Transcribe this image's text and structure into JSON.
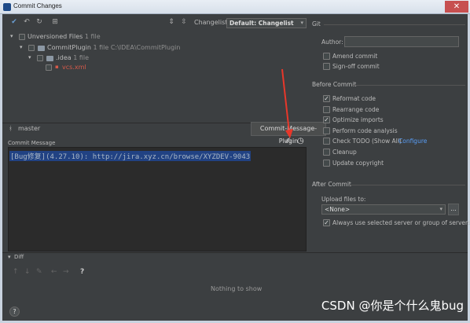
{
  "window": {
    "title": "Commit Changes",
    "close_glyph": "✕"
  },
  "toolbar": {
    "changelist_label": "Changelist:",
    "changelist_value": "Default: Changelist"
  },
  "tree": {
    "unversioned_label": "Unversioned Files",
    "unversioned_count": "1 file",
    "project_label": "CommitPlugin",
    "project_info": "1 file C:\\IDEA\\CommitPlugin",
    "folder_label": ".idea",
    "folder_count": "1 file",
    "file_label": "vcs.xml"
  },
  "branch": {
    "name": "master"
  },
  "commit_message": {
    "section_label": "Commit Message",
    "text": "[Bug修复](4.27.10): http://jira.xyz.cn/browse/XYZDEV-9043",
    "tooltip": "Commit-Message-Plugin"
  },
  "git": {
    "section_label": "Git",
    "author_label": "Author:",
    "author_value": "",
    "amend_label": "Amend commit",
    "amend_checked": false,
    "signoff_label": "Sign-off commit",
    "signoff_checked": false
  },
  "before_commit": {
    "section_label": "Before Commit",
    "options": [
      {
        "label": "Reformat code",
        "checked": true
      },
      {
        "label": "Rearrange code",
        "checked": false
      },
      {
        "label": "Optimize imports",
        "checked": true
      },
      {
        "label": "Perform code analysis",
        "checked": false
      },
      {
        "label": "Check TODO (Show All)",
        "checked": false,
        "link": "Configure"
      },
      {
        "label": "Cleanup",
        "checked": false
      },
      {
        "label": "Update copyright",
        "checked": false
      }
    ]
  },
  "after_commit": {
    "section_label": "After Commit",
    "upload_label": "Upload files to:",
    "upload_value": "<None>",
    "browse_label": "...",
    "always_use_label": "Always use selected server or group of servers",
    "always_use_checked": true
  },
  "diff": {
    "section_label": "Diff",
    "empty_text": "Nothing to show"
  },
  "footer": {
    "help_label": "?",
    "watermark": "CSDN @你是个什么鬼bug"
  },
  "colors": {
    "background": "#3c3f41",
    "editor_bg": "#2b2b2b",
    "selection": "#214283",
    "link": "#589df6",
    "unversioned_file": "#d65a4a",
    "close_button": "#c75050",
    "arrow": "#e8372a"
  },
  "icons": [
    "app-icon",
    "check-vcs-icon",
    "undo-icon",
    "refresh-icon",
    "group-by-icon",
    "expand-all-icon",
    "collapse-all-icon",
    "commit-message-plugin-icon",
    "history-icon",
    "red-arrow-annotation",
    "branch-icon",
    "folder-icon",
    "file-icon"
  ]
}
